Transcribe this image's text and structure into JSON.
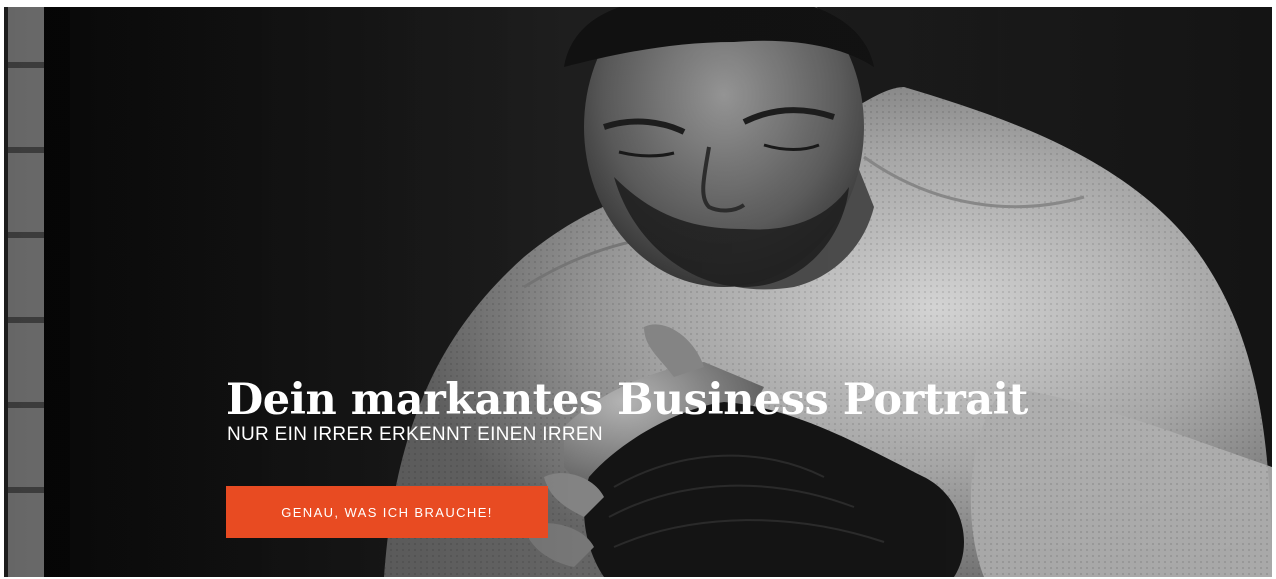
{
  "hero": {
    "title": "Dein markantes Business Portrait",
    "subtitle": "NUR EIN IRRER ERKENNT EINEN IRREN",
    "cta_label": "GENAU, WAS ICH BRAUCHE!",
    "cta_color": "#e84b22"
  }
}
